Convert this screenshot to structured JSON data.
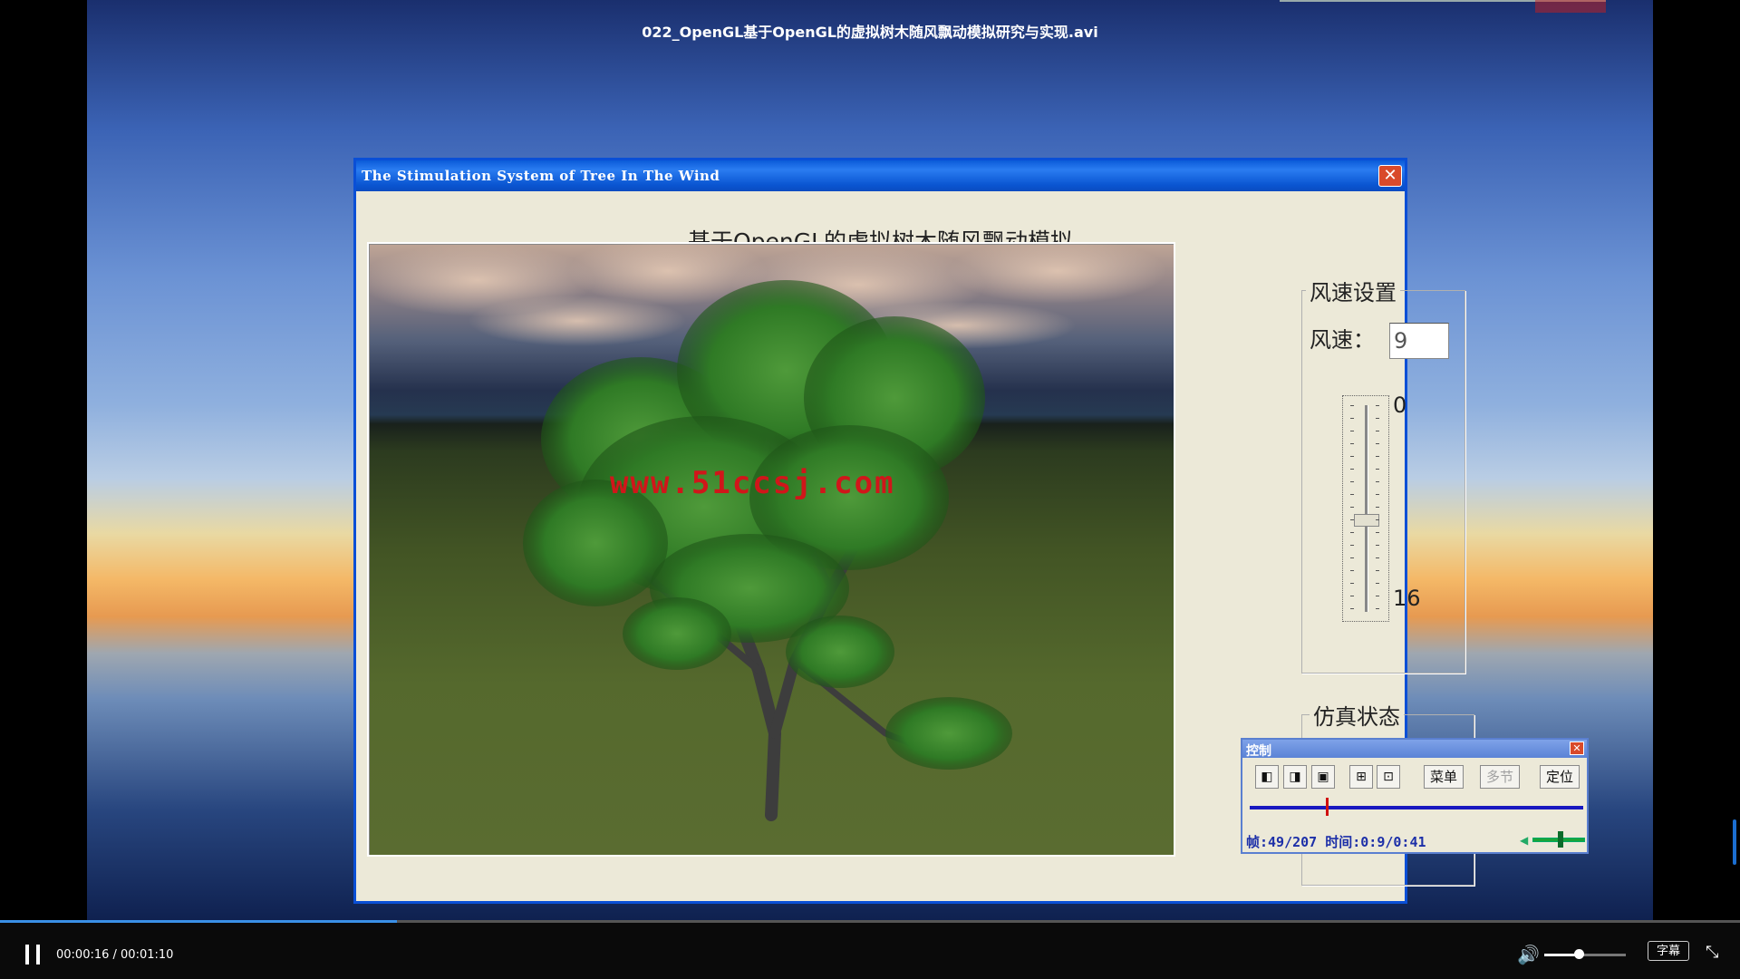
{
  "video": {
    "title": "022_OpenGL基于OpenGL的虚拟树木随风飘动模拟研究与实现.avi"
  },
  "app_window": {
    "title": "The Stimulation System of Tree In The Wind",
    "close_label": "✕",
    "heading": "基于OpenGL的虚拟树木随风飘动模拟",
    "viewport": {
      "watermark": "www.51ccsj.com"
    },
    "wind_settings": {
      "group_label": "风速设置",
      "wind_label": "风速：",
      "wind_value": "9",
      "slider_min": "0",
      "slider_max": "16",
      "slider_value": 9
    },
    "sim_status": {
      "group_label": "仿真状态"
    }
  },
  "control_panel": {
    "title": "控制",
    "close_label": "✕",
    "buttons": [
      "◧",
      "◨",
      "▣",
      "⊞",
      "⊡"
    ],
    "menu_label": "菜单",
    "multi_label": "多节",
    "locate_label": "定位",
    "frame_info": "帧:49/207 时间:0:9/0:41",
    "frame_current": 49,
    "frame_total": 207
  },
  "player": {
    "time": "00:00:16 / 00:01:10",
    "progress": 0.228,
    "volume": 0.42,
    "subtitle_label": "字幕",
    "volume_icon": "speaker-icon",
    "fullscreen_icon": "exit-fullscreen-icon"
  }
}
